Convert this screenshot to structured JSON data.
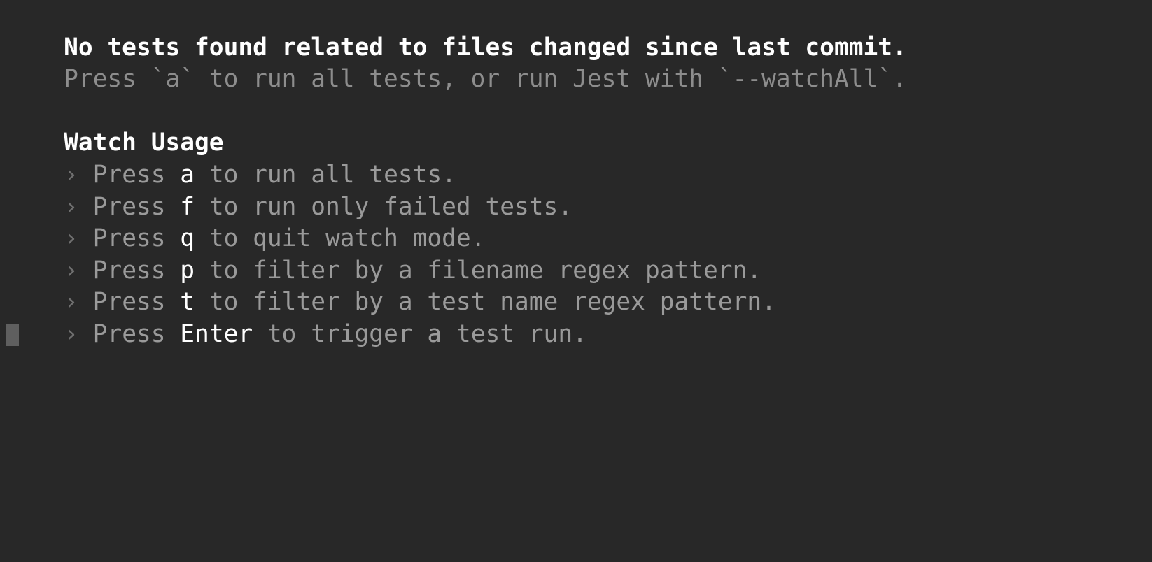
{
  "terminal": {
    "background_color": "#282828",
    "colors": {
      "heading": "#ffffff",
      "body": "#9a9a9a",
      "dim": "#8d8d8d",
      "chevron": "#6f6f6f",
      "key": "#ffffff",
      "cursor": "#5f5f5f"
    },
    "status": {
      "headline": "No tests found related to files changed since last commit.",
      "hint": "Press `a` to run all tests, or run Jest with `--watchAll`."
    },
    "watch_usage": {
      "title": "Watch Usage",
      "bullet": "›",
      "items": [
        {
          "prefix": "Press ",
          "key": "a",
          "suffix": " to run all tests."
        },
        {
          "prefix": "Press ",
          "key": "f",
          "suffix": " to run only failed tests."
        },
        {
          "prefix": "Press ",
          "key": "q",
          "suffix": " to quit watch mode."
        },
        {
          "prefix": "Press ",
          "key": "p",
          "suffix": " to filter by a filename regex pattern."
        },
        {
          "prefix": "Press ",
          "key": "t",
          "suffix": " to filter by a test name regex pattern."
        },
        {
          "prefix": "Press ",
          "key": "Enter",
          "suffix": " to trigger a test run."
        }
      ]
    },
    "cursor": {
      "glyph": "block-cursor"
    }
  }
}
